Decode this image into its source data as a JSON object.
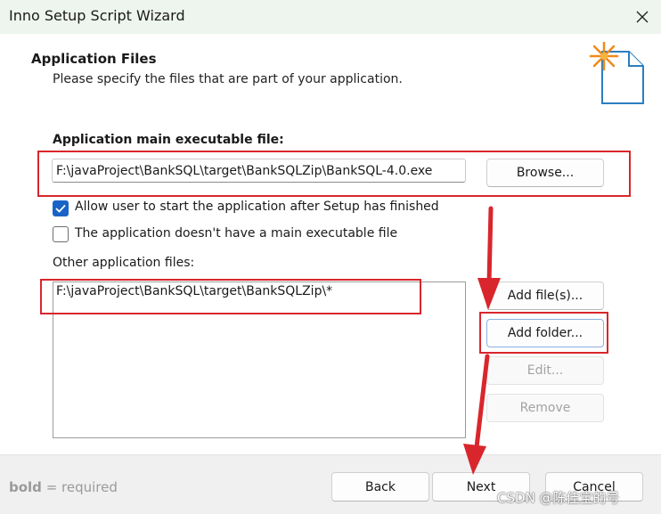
{
  "window": {
    "title": "Inno Setup Script Wizard",
    "close_glyph": "✕"
  },
  "header": {
    "title": "Application Files",
    "subtitle": "Please specify the files that are part of your application."
  },
  "main_exe": {
    "label": "Application main executable file:",
    "value": "F:\\javaProject\\BankSQL\\target\\BankSQLZip\\BankSQL-4.0.exe",
    "browse_label": "Browse..."
  },
  "options": {
    "allow_start": {
      "label": "Allow user to start the application after Setup has finished",
      "checked": true
    },
    "no_main_exe": {
      "label": "The application doesn't have a main executable file",
      "checked": false
    }
  },
  "other_files": {
    "label": "Other application files:",
    "items": [
      "F:\\javaProject\\BankSQL\\target\\BankSQLZip\\*"
    ],
    "add_files_label": "Add file(s)...",
    "add_folder_label": "Add folder...",
    "edit_label": "Edit...",
    "remove_label": "Remove"
  },
  "footer": {
    "required_note_bold": "bold",
    "required_note_rest": " = required",
    "back_label": "Back",
    "next_label": "Next",
    "cancel_label": "Cancel"
  },
  "watermark": "CSDN @陈佳宝的号",
  "colors": {
    "accent": "#1a63c6",
    "annotation_red": "#d9262c"
  }
}
